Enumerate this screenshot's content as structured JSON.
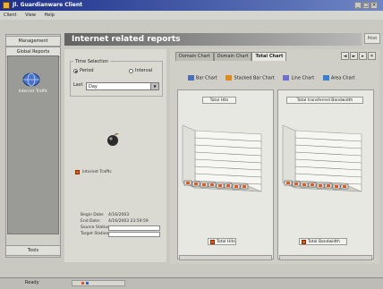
{
  "window": {
    "title": "Jl. Guardianware Client",
    "buttons": [
      "_",
      "□",
      "×"
    ]
  },
  "menu": [
    "Client",
    "View",
    "Help"
  ],
  "sidebar": {
    "top_buttons": [
      "Management",
      "Global Reports"
    ],
    "app_label": "Internet Traffic",
    "bottom_button": "Tools"
  },
  "header": {
    "title": "Internet related reports",
    "print_label": "Print"
  },
  "time_selection": {
    "label": "Time Selection",
    "options": [
      "Period",
      "Interval"
    ],
    "last_label": "Last",
    "last_value": "Day"
  },
  "left_legend": {
    "label": "Internet Traffic",
    "color": "#e25a1c"
  },
  "details": [
    {
      "label": "Begin Date:",
      "value": "4/16/2003"
    },
    {
      "label": "End Date:",
      "value": "4/16/2003 23:59:59"
    },
    {
      "label": "Source Station:",
      "value": ""
    },
    {
      "label": "Target Station:",
      "value": ""
    }
  ],
  "tabs": [
    "Domain Chart",
    "Domain Chart",
    "Total Chart"
  ],
  "nav_buttons": [
    "◄",
    "►",
    "▸",
    "✕"
  ],
  "chart_types": [
    {
      "label": "Bar Chart",
      "color": "#4d6fb3"
    },
    {
      "label": "Stacked Bar Chart",
      "color": "#e08a1e"
    },
    {
      "label": "Line Chart",
      "color": "#6f6fd0"
    },
    {
      "label": "Area Chart",
      "color": "#3c7fd0"
    }
  ],
  "panels": [
    {
      "title": "Total Hits",
      "legend": "Total Hits"
    },
    {
      "title": "Total transferred Bandwidth",
      "legend": "Total Bandwidth"
    }
  ],
  "status": {
    "text": "Ready"
  }
}
